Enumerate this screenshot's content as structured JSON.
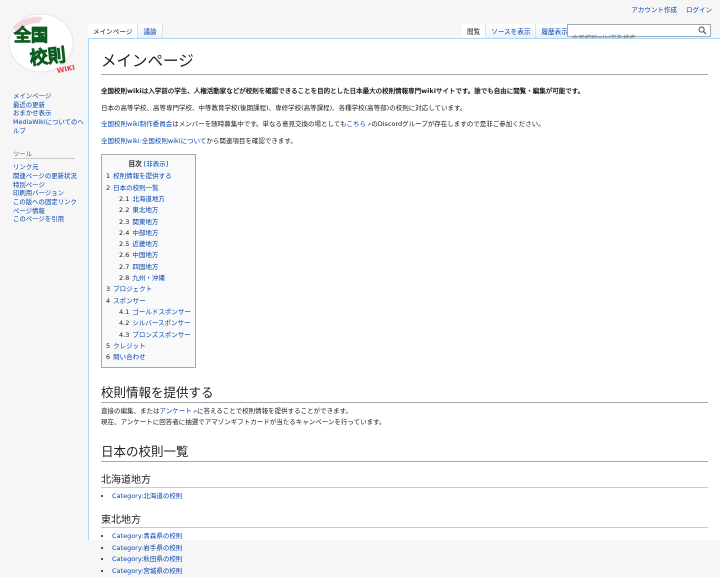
{
  "personal_tools": {
    "create_account": "アカウント作成",
    "login": "ログイン"
  },
  "logo": {
    "line1": "全国",
    "line2": "校則",
    "line3": "WIKI"
  },
  "sidebar": {
    "nav": [
      "メインページ",
      "最近の更新",
      "おまかせ表示",
      "MediaWikiについてのヘルプ"
    ],
    "tools_heading": "ツール",
    "tools": [
      "リンク元",
      "関連ページの更新状況",
      "特別ページ",
      "印刷用バージョン",
      "この版への固定リンク",
      "ページ情報",
      "このページを引用"
    ]
  },
  "tabs": {
    "left": [
      "メインページ",
      "議論"
    ],
    "right": [
      "閲覧",
      "ソースを表示",
      "履歴表示"
    ]
  },
  "search": {
    "placeholder": "全国校則wiki内を検索"
  },
  "page": {
    "title": "メインページ",
    "intro_bold": "全国校則wikiは入学前の学生、人権活動家などが校則を確認できることを目的とした日本最大の校則情報専門wikiサイトです。誰でも自由に閲覧・編集が可能です。",
    "intro2": "日本の高等学校、高等専門学校、中等教育学校(後期課程)、専修学校(高等課程)、各種学校(高等部)の校則に対応しています。",
    "intro3": {
      "link1": "全国校則wiki制作委員会",
      "text1": "はメンバーを随時募集中です。単なる意見交換の場としてもこちら",
      "link2": "こちら",
      "pre": "はメンバーを随時募集中です。単なる意見交換の場としても",
      "text2": "のDiscordグループが存在しますので是非ご参加ください。"
    },
    "intro4": {
      "link": "全国校則wiki:全国校則wikiについて",
      "text": "から関連項目を確認できます。"
    }
  },
  "toc": {
    "title": "目次",
    "toggle": "[非表示]",
    "items": [
      {
        "num": "1",
        "label": "校則情報を提供する",
        "level": 1
      },
      {
        "num": "2",
        "label": "日本の校則一覧",
        "level": 1
      },
      {
        "num": "2.1",
        "label": "北海道地方",
        "level": 2
      },
      {
        "num": "2.2",
        "label": "東北地方",
        "level": 2
      },
      {
        "num": "2.3",
        "label": "関東地方",
        "level": 2
      },
      {
        "num": "2.4",
        "label": "中部地方",
        "level": 2
      },
      {
        "num": "2.5",
        "label": "近畿地方",
        "level": 2
      },
      {
        "num": "2.6",
        "label": "中国地方",
        "level": 2
      },
      {
        "num": "2.7",
        "label": "四国地方",
        "level": 2
      },
      {
        "num": "2.8",
        "label": "九州・沖縄",
        "level": 2
      },
      {
        "num": "3",
        "label": "プロジェクト",
        "level": 1
      },
      {
        "num": "4",
        "label": "スポンサー",
        "level": 1
      },
      {
        "num": "4.1",
        "label": "ゴールドスポンサー",
        "level": 2
      },
      {
        "num": "4.2",
        "label": "シルバースポンサー",
        "level": 2
      },
      {
        "num": "4.3",
        "label": "ブロンズスポンサー",
        "level": 2
      },
      {
        "num": "5",
        "label": "クレジット",
        "level": 1
      },
      {
        "num": "6",
        "label": "問い合わせ",
        "level": 1
      }
    ]
  },
  "section1": {
    "heading": "校則情報を提供する",
    "line1_pre": "直接の編集、または",
    "line1_link": "アンケート",
    "line1_post": "に答えることで校則情報を提供することができます。",
    "line2": "現在、アンケートに回答者に抽選でアマゾンギフトカードが当たるキャンペーンを行っています。"
  },
  "section2": {
    "heading": "日本の校則一覧",
    "hokkaido": {
      "heading": "北海道地方",
      "links": [
        "Category:北海道の校則"
      ]
    },
    "tohoku": {
      "heading": "東北地方",
      "links": [
        "Category:青森県の校則",
        "Category:岩手県の校則",
        "Category:秋田県の校則",
        "Category:宮城県の校則"
      ]
    }
  },
  "colors": {
    "link": "#0645ad",
    "border": "#a7d7f9",
    "logo_green": "#2bb24c",
    "logo_red": "#e63946"
  }
}
